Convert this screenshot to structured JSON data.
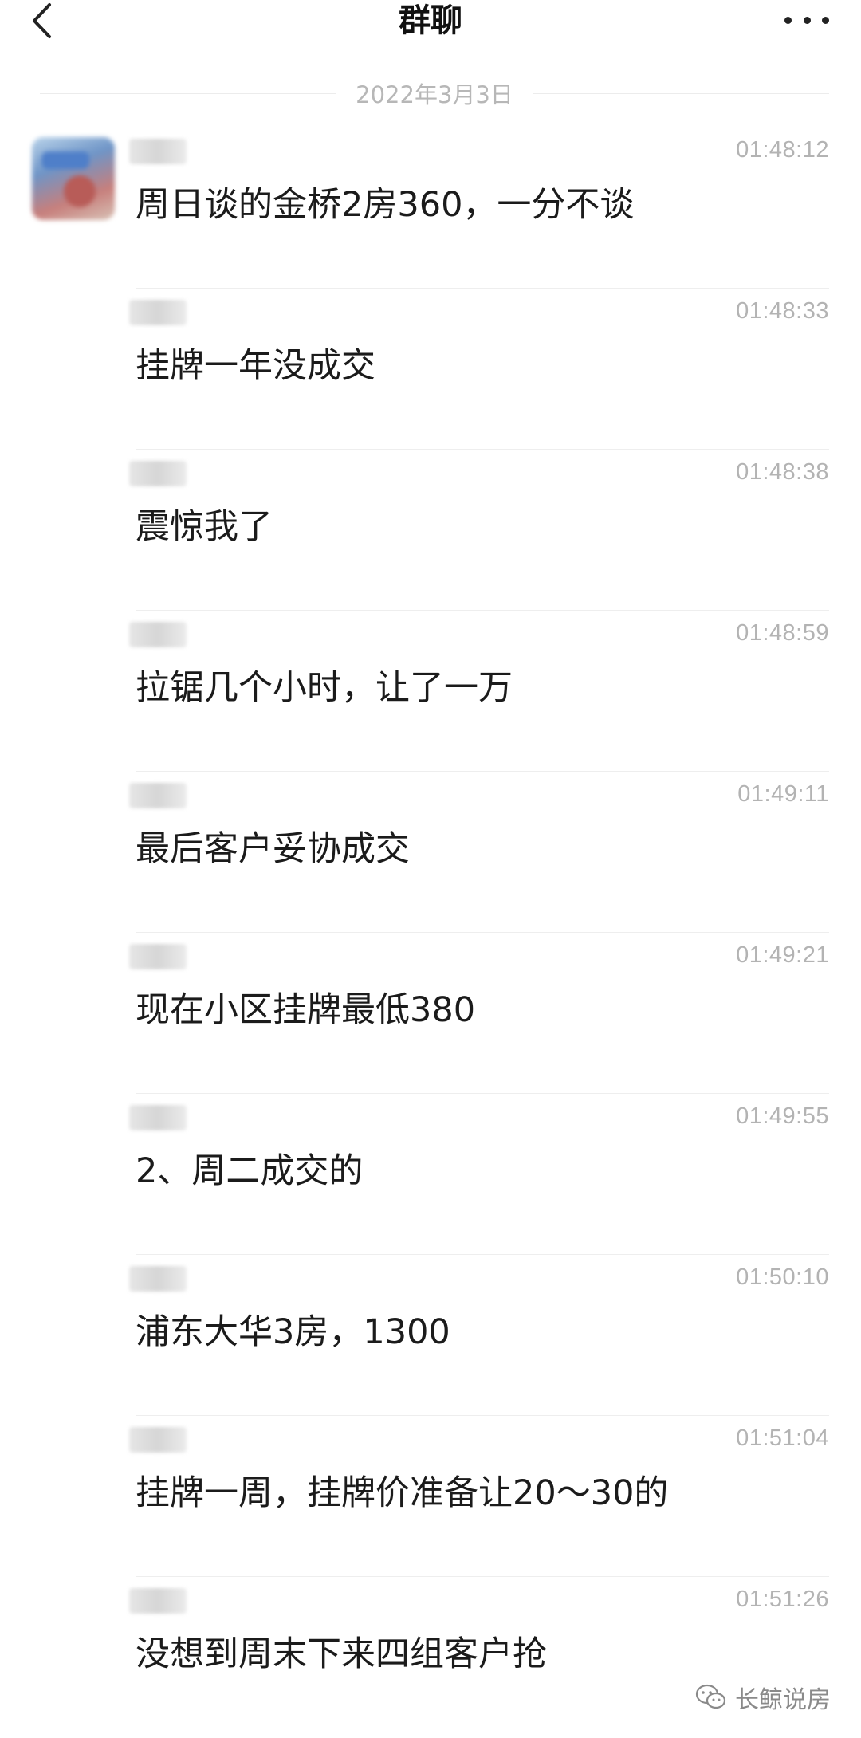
{
  "header": {
    "title": "群聊"
  },
  "date_divider": "2022年3月3日",
  "messages": [
    {
      "time": "01:48:12",
      "text": "周日谈的金桥2房360，一分不谈"
    },
    {
      "time": "01:48:33",
      "text": "挂牌一年没成交"
    },
    {
      "time": "01:48:38",
      "text": "震惊我了"
    },
    {
      "time": "01:48:59",
      "text": "拉锯几个小时，让了一万"
    },
    {
      "time": "01:49:11",
      "text": "最后客户妥协成交"
    },
    {
      "time": "01:49:21",
      "text": "现在小区挂牌最低380"
    },
    {
      "time": "01:49:55",
      "text": "2、周二成交的"
    },
    {
      "time": "01:50:10",
      "text": "浦东大华3房，1300"
    },
    {
      "time": "01:51:04",
      "text": "挂牌一周，挂牌价准备让20～30的"
    },
    {
      "time": "01:51:26",
      "text": "没想到周末下来四组客户抢"
    }
  ],
  "watermark": {
    "text": "长鲸说房",
    "icon": "wechat-icon"
  }
}
